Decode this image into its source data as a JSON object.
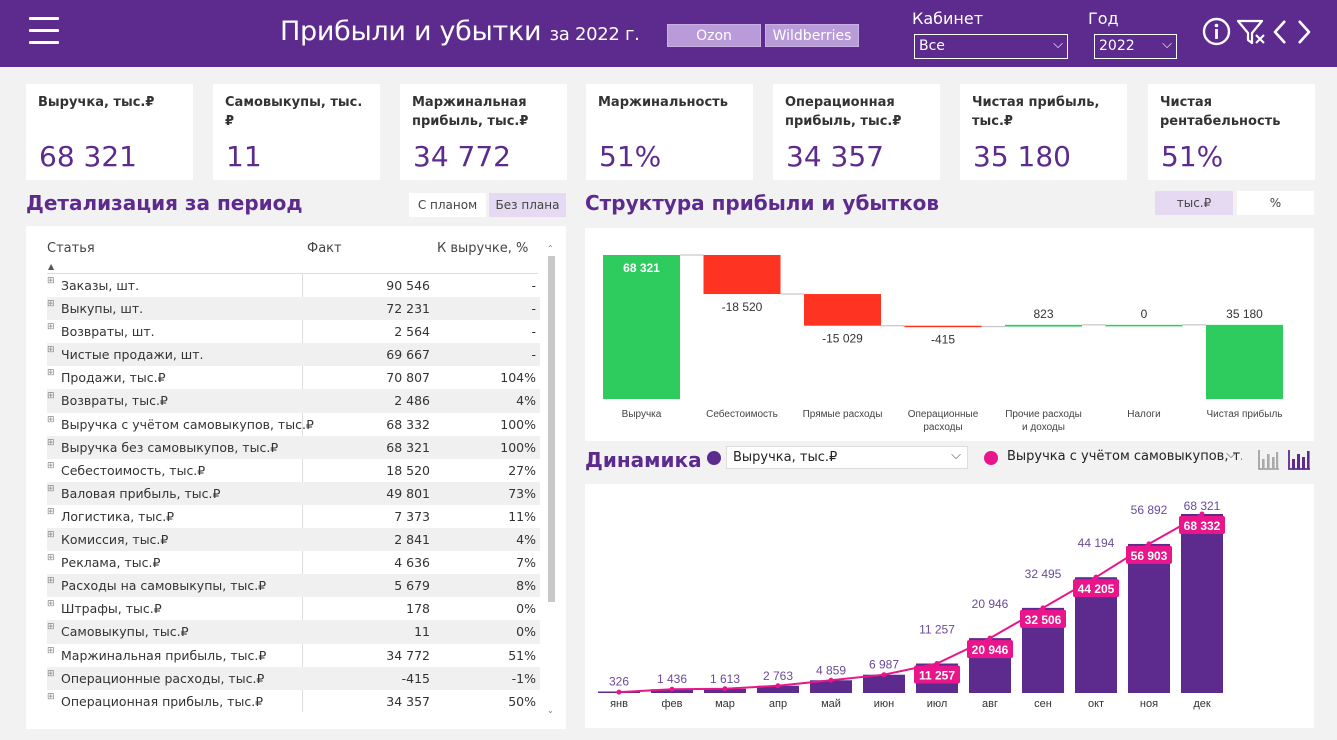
{
  "header": {
    "title": "Прибыли и убытки",
    "title_year": "за 2022 г.",
    "marketplaces": [
      "Ozon",
      "Wildberries"
    ],
    "cabinet_label": "Кабинет",
    "cabinet_value": "Все",
    "year_label": "Год",
    "year_value": "2022"
  },
  "colors": {
    "accent": "#5d2b8e",
    "pink": "#e8168a",
    "positive": "#2ecc5e",
    "negative": "#ff3322"
  },
  "kpis": [
    {
      "title": "Выручка, тыс.₽",
      "value": "68 321"
    },
    {
      "title": "Самовыкупы, тыс.₽",
      "value": "11"
    },
    {
      "title": "Маржинальная прибыль, тыс.₽",
      "value": "34 772"
    },
    {
      "title": "Маржинальность",
      "value": "51%"
    },
    {
      "title": "Операционная прибыль, тыс.₽",
      "value": "34 357"
    },
    {
      "title": "Чистая прибыль, тыс.₽",
      "value": "35 180"
    },
    {
      "title": "Чистая рентабельность",
      "value": "51%"
    }
  ],
  "detail": {
    "title": "Детализация за период",
    "toggles": [
      "С планом",
      "Без плана"
    ],
    "columns": [
      "Статья",
      "Факт",
      "К выручке, %"
    ],
    "rows": [
      [
        "Заказы, шт.",
        "90 546",
        "-"
      ],
      [
        "Выкупы, шт.",
        "72 231",
        "-"
      ],
      [
        "Возвраты, шт.",
        "2 564",
        "-"
      ],
      [
        "Чистые продажи, шт.",
        "69 667",
        "-"
      ],
      [
        "Продажи, тыс.₽",
        "70 807",
        "104%"
      ],
      [
        "Возвраты, тыс.₽",
        "2 486",
        "4%"
      ],
      [
        "Выручка с учётом самовыкупов, тыс.₽",
        "68 332",
        "100%"
      ],
      [
        "Выручка без самовыкупов, тыс.₽",
        "68 321",
        "100%"
      ],
      [
        "Себестоимость, тыс.₽",
        "18 520",
        "27%"
      ],
      [
        "Валовая прибыль, тыс.₽",
        "49 801",
        "73%"
      ],
      [
        "Логистика, тыс.₽",
        "7 373",
        "11%"
      ],
      [
        "Комиссия, тыс.₽",
        "2 841",
        "4%"
      ],
      [
        "Реклама, тыс.₽",
        "4 636",
        "7%"
      ],
      [
        "Расходы на самовыкупы, тыс.₽",
        "5 679",
        "8%"
      ],
      [
        "Штрафы, тыс.₽",
        "178",
        "0%"
      ],
      [
        "Самовыкупы, тыс.₽",
        "11",
        "0%"
      ],
      [
        "Маржинальная прибыль, тыс.₽",
        "34 772",
        "51%"
      ],
      [
        "Операционные расходы, тыс.₽",
        "-415",
        "-1%"
      ],
      [
        "Операционная прибыль, тыс.₽",
        "34 357",
        "50%"
      ]
    ]
  },
  "structure": {
    "title": "Структура прибыли и убытков",
    "toggles": [
      "тыс.₽",
      "%"
    ]
  },
  "dynamics": {
    "title": "Динамика",
    "select1": "Выручка, тыс.₽",
    "select2": "Выручка с учётом самовыкупов, т..."
  },
  "chart_data": [
    {
      "type": "waterfall",
      "categories": [
        "Выручка",
        "Себестоимость",
        "Прямые расходы",
        "Операционные расходы",
        "Прочие расходы и доходы",
        "Налоги",
        "Чистая прибыль"
      ],
      "values": [
        68321,
        -18520,
        -15029,
        -415,
        823,
        0,
        35180
      ],
      "labels": [
        "68 321",
        "-18 520",
        "-15 029",
        "-415",
        "823",
        "0",
        "35 180"
      ],
      "kinds": [
        "total",
        "delta",
        "delta",
        "delta",
        "delta",
        "delta",
        "total"
      ]
    },
    {
      "type": "bar+line",
      "categories": [
        "янв",
        "фев",
        "мар",
        "апр",
        "май",
        "июн",
        "июл",
        "авг",
        "сен",
        "окт",
        "ноя",
        "дек"
      ],
      "series": [
        {
          "name": "Выручка, тыс.₽",
          "type": "bar",
          "values": [
            326,
            1436,
            1613,
            2763,
            4859,
            6987,
            11257,
            20946,
            32495,
            44194,
            56892,
            68321
          ],
          "labels": [
            "326",
            "1 436",
            "1 613",
            "2 763",
            "4 859",
            "6 987",
            "11 257",
            "20 946",
            "32 495",
            "44 194",
            "56 892",
            "68 321"
          ]
        },
        {
          "name": "Выручка с учётом самовыкупов, т...",
          "type": "line",
          "values": [
            326,
            1436,
            1613,
            2763,
            4859,
            6987,
            11257,
            20946,
            32506,
            44205,
            56903,
            68332
          ],
          "labels": [
            "",
            "",
            "",
            "",
            "",
            "",
            "11 257",
            "20 946",
            "32 506",
            "44 205",
            "56 903",
            "68 332"
          ]
        }
      ]
    }
  ]
}
